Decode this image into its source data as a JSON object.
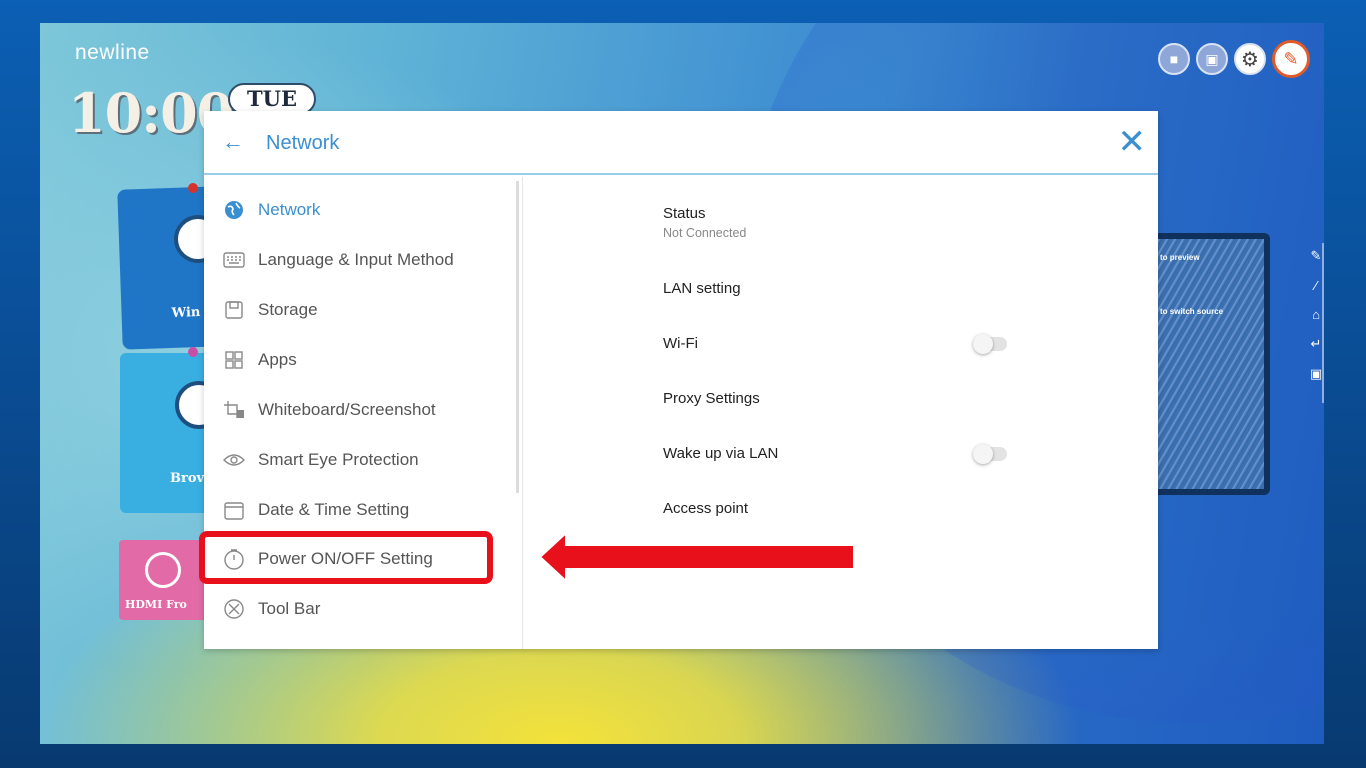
{
  "desktop": {
    "brand": "newline",
    "time": "10:00",
    "day": "TUE",
    "tiles": {
      "windows_label": "Win",
      "browser_label": "Brov",
      "hdmi_label": "HDMI Fro"
    },
    "top_icons": [
      "lock-icon",
      "monitor-icon",
      "gear-icon",
      "note-icon"
    ],
    "preview": {
      "line1": "to preview",
      "line2": "to switch source"
    }
  },
  "settings": {
    "header": {
      "back_glyph": "←",
      "title": "Network",
      "close_glyph": "✕"
    },
    "menu": [
      {
        "label": "Network",
        "icon": "globe-icon",
        "active": true
      },
      {
        "label": "Language & Input Method",
        "icon": "keyboard-icon",
        "active": false
      },
      {
        "label": "Storage",
        "icon": "storage-icon",
        "active": false
      },
      {
        "label": "Apps",
        "icon": "apps-icon",
        "active": false
      },
      {
        "label": "Whiteboard/Screenshot",
        "icon": "crop-icon",
        "active": false
      },
      {
        "label": "Smart Eye Protection",
        "icon": "eye-icon",
        "active": false
      },
      {
        "label": "Date & Time Setting",
        "icon": "calendar-icon",
        "active": false
      },
      {
        "label": "Power ON/OFF Setting",
        "icon": "power-timer-icon",
        "active": false
      },
      {
        "label": "Tool Bar",
        "icon": "tools-icon",
        "active": false
      }
    ],
    "content": {
      "status_label": "Status",
      "status_value": "Not Connected",
      "lan_label": "LAN setting",
      "wifi_label": "Wi-Fi",
      "wifi_on": false,
      "proxy_label": "Proxy Settings",
      "wake_lan_label": "Wake up via LAN",
      "wake_lan_on": false,
      "access_point_label": "Access point"
    }
  },
  "annotation": {
    "highlight_color": "#e8101a",
    "arrow_color": "#e8101a"
  }
}
